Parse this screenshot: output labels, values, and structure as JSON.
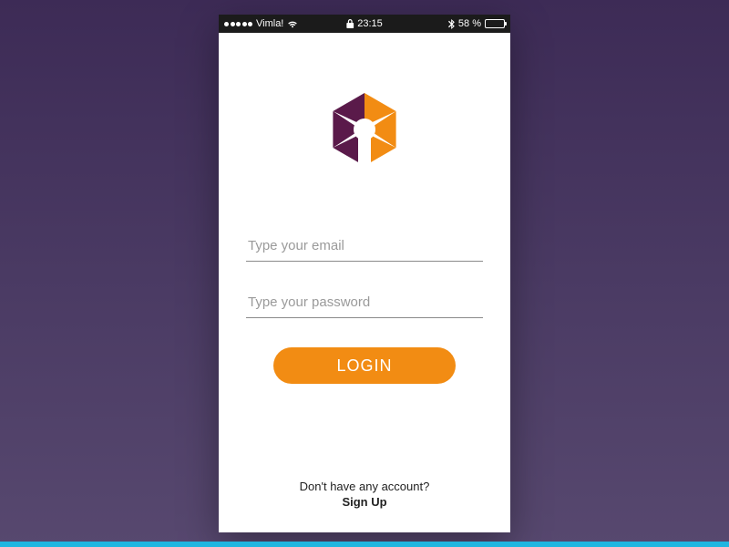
{
  "status_bar": {
    "carrier": "Vimla!",
    "time": "23:15",
    "battery_percent": "58 %"
  },
  "form": {
    "email_placeholder": "Type your email",
    "password_placeholder": "Type your password",
    "login_label": "LOGIN"
  },
  "footer": {
    "prompt": "Don't have any account?",
    "signup_label": "Sign Up"
  },
  "colors": {
    "accent_orange": "#f28c13",
    "accent_purple": "#5a1a4a"
  }
}
